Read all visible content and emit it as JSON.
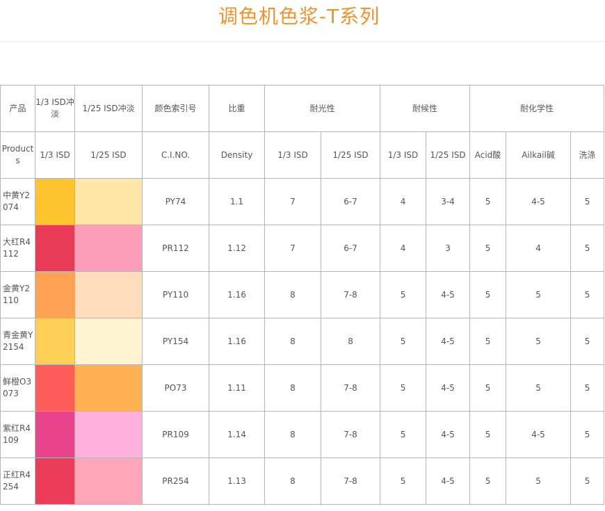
{
  "title": "调色机色浆-T系列",
  "header1": {
    "product": "产品",
    "isd13": "1/3 ISD冲淡",
    "isd125": "1/25 ISD冲淡",
    "cino": "颜色索引号",
    "density": "比重",
    "light": "耐光性",
    "weather": "耐候性",
    "chem": "耐化学性"
  },
  "header2": {
    "product": "Products",
    "isd13": "1/3 ISD",
    "isd125": "1/25 ISD",
    "cino": "C.I.NO.",
    "density": "Density",
    "light13": "1/3 ISD",
    "light125": "1/25 ISD",
    "weather13": "1/3 ISD",
    "weather125": "1/25 ISD",
    "acid": "Acid酸",
    "alkali": "Ailkail碱",
    "wash": "洗涤"
  },
  "rows": [
    {
      "name": "中黄Y2074",
      "swatch13": "#ffc42e",
      "swatch125": "#fde6a8",
      "ci": "PY74",
      "density": "1.1",
      "light13": "7",
      "light125": "6-7",
      "weather13": "4",
      "weather125": "3-4",
      "acid": "5",
      "alkali": "4-5",
      "wash": "5"
    },
    {
      "name": "大红R4112",
      "swatch13": "#e93a57",
      "swatch125": "#fd9fbb",
      "ci": "PR112",
      "density": "1.12",
      "light13": "7",
      "light125": "6-7",
      "weather13": "4",
      "weather125": "3",
      "acid": "5",
      "alkali": "4",
      "wash": "5"
    },
    {
      "name": "金黄Y2110",
      "swatch13": "#ffa152",
      "swatch125": "#ffdcbc",
      "ci": "PY110",
      "density": "1.16",
      "light13": "8",
      "light125": "7-8",
      "weather13": "5",
      "weather125": "4-5",
      "acid": "5",
      "alkali": "5",
      "wash": "5"
    },
    {
      "name": "青金黄Y2154",
      "swatch13": "#ffd055",
      "swatch125": "#fff3d2",
      "ci": "PY154",
      "density": "1.16",
      "light13": "8",
      "light125": "8",
      "weather13": "5",
      "weather125": "4-5",
      "acid": "5",
      "alkali": "5",
      "wash": "5"
    },
    {
      "name": "鲜橙O3073",
      "swatch13": "#ff5d59",
      "swatch125": "#ffb153",
      "ci": "PO73",
      "density": "1.11",
      "light13": "8",
      "light125": "7-8",
      "weather13": "5",
      "weather125": "4-5",
      "acid": "5",
      "alkali": "5",
      "wash": "5"
    },
    {
      "name": "紫红R4109",
      "swatch13": "#e8448b",
      "swatch125": "#ffb1dd",
      "ci": "PR109",
      "density": "1.14",
      "light13": "8",
      "light125": "7-8",
      "weather13": "5",
      "weather125": "4-5",
      "acid": "5",
      "alkali": "4-5",
      "wash": "5"
    },
    {
      "name": "正红R4254",
      "swatch13": "#ed3c5a",
      "swatch125": "#ffa6b9",
      "ci": "PR254",
      "density": "1.13",
      "light13": "8",
      "light125": "7-8",
      "weather13": "5",
      "weather125": "4-5",
      "acid": "5",
      "alkali": "5",
      "wash": "5"
    }
  ]
}
